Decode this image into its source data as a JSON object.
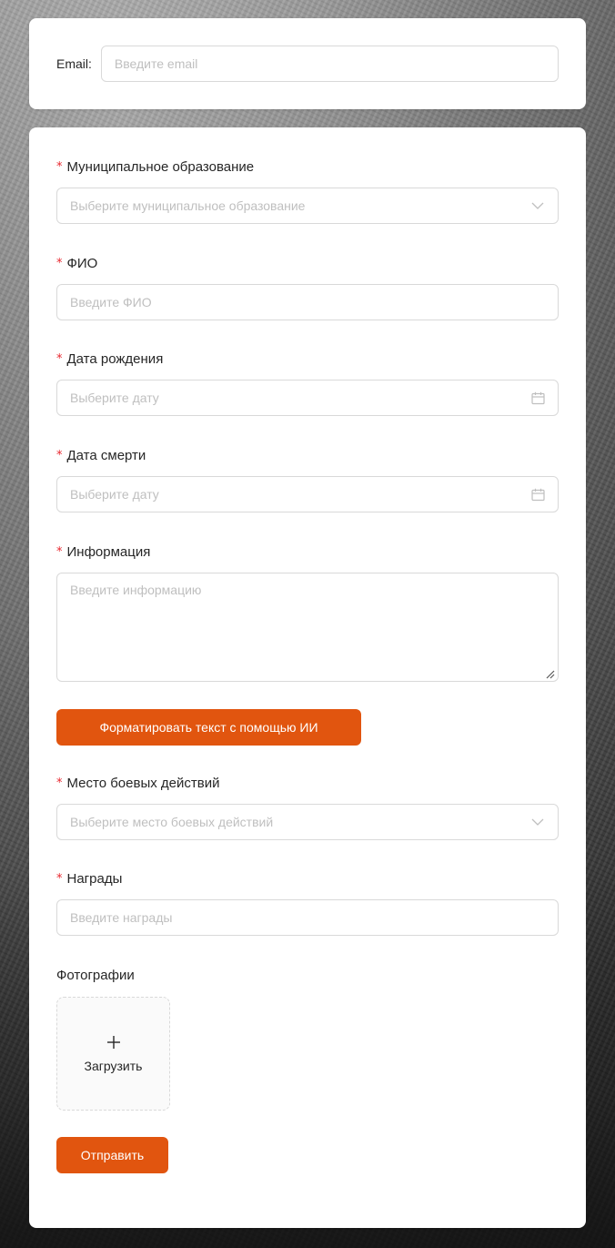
{
  "theme": {
    "accent": "#e1550f",
    "required_star": "#e8262e",
    "placeholder": "#bfbfbf",
    "border": "#d9d9d9"
  },
  "email_card": {
    "label": "Email:",
    "placeholder": "Введите email"
  },
  "form": {
    "required_mark": "*",
    "municipality": {
      "label": "Муниципальное образование",
      "placeholder": "Выберите муниципальное образование",
      "icon": "chevron-down-icon"
    },
    "fio": {
      "label": "ФИО",
      "placeholder": "Введите ФИО"
    },
    "birth_date": {
      "label": "Дата рождения",
      "placeholder": "Выберите дату",
      "icon": "calendar-icon"
    },
    "death_date": {
      "label": "Дата смерти",
      "placeholder": "Выберите дату",
      "icon": "calendar-icon"
    },
    "info": {
      "label": "Информация",
      "placeholder": "Введите информацию"
    },
    "format_button_label": "Форматировать текст с помощью ИИ",
    "battle_place": {
      "label": "Место боевых действий",
      "placeholder": "Выберите место боевых действий",
      "icon": "chevron-down-icon"
    },
    "awards": {
      "label": "Награды",
      "placeholder": "Введите награды"
    },
    "photos": {
      "label": "Фотографии",
      "upload_label": "Загрузить",
      "icon": "plus-icon"
    },
    "submit_label": "Отправить"
  }
}
